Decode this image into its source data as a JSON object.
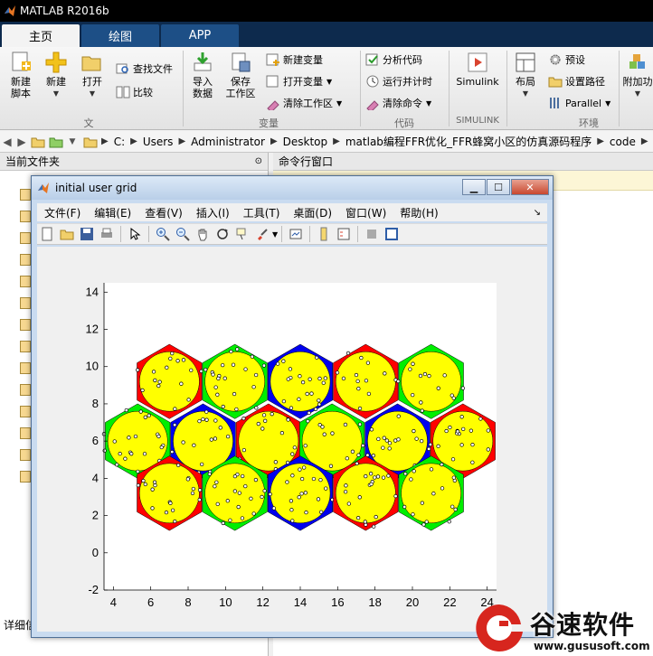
{
  "app": {
    "title": "MATLAB R2016b"
  },
  "tabs": [
    {
      "label": "主页",
      "active": true
    },
    {
      "label": "绘图",
      "active": false
    },
    {
      "label": "APP",
      "active": false
    }
  ],
  "ribbon": {
    "new_script": "新建\n脚本",
    "new": "新建",
    "open": "打开",
    "find_files": "查找文件",
    "compare": "比较",
    "import_data": "导入\n数据",
    "save_workspace": "保存\n工作区",
    "new_variable": "新建变量",
    "open_variable": "打开变量",
    "clear_workspace": "清除工作区",
    "analyze_code": "分析代码",
    "run_and_time": "运行并计时",
    "clear_commands": "清除命令",
    "simulink": "Simulink",
    "layout": "布局",
    "preferences": "预设",
    "set_path": "设置路径",
    "parallel": "Parallel",
    "addons": "附加功",
    "groups": {
      "file": "文件",
      "variable": "变量",
      "code": "代码",
      "simulink": "SIMULINK",
      "environment": "环境"
    }
  },
  "address": {
    "crumbs": [
      "C:",
      "Users",
      "Administrator",
      "Desktop",
      "matlab编程FFR优化_FFR蜂窝小区的仿真源码程序",
      "code"
    ]
  },
  "left_panel": {
    "title": "当前文件夹",
    "detail": "详细信"
  },
  "right_panel": {
    "title": "命令行窗口"
  },
  "figure": {
    "title": "initial user grid",
    "menu": [
      "文件(F)",
      "编辑(E)",
      "查看(V)",
      "插入(I)",
      "工具(T)",
      "桌面(D)",
      "窗口(W)",
      "帮助(H)"
    ]
  },
  "chart_data": {
    "type": "scatter",
    "title": "",
    "xlabel": "",
    "ylabel": "",
    "xlim": [
      3.5,
      24.5
    ],
    "ylim": [
      -2,
      14.5
    ],
    "xticks": [
      4,
      6,
      8,
      10,
      12,
      14,
      16,
      18,
      20,
      22,
      24
    ],
    "yticks": [
      -2,
      0,
      2,
      4,
      6,
      8,
      10,
      12,
      14
    ],
    "hex_radius": 2,
    "inner_circle_radius": 1.6,
    "colors": {
      "red": "#ff0000",
      "green": "#00ee00",
      "blue": "#0000ee",
      "yellow": "#ffff00"
    },
    "cells": [
      {
        "cx": 7,
        "cy": 9.2,
        "color": "red"
      },
      {
        "cx": 10.5,
        "cy": 9.2,
        "color": "green"
      },
      {
        "cx": 14,
        "cy": 9.2,
        "color": "blue"
      },
      {
        "cx": 17.5,
        "cy": 9.2,
        "color": "red"
      },
      {
        "cx": 21,
        "cy": 9.2,
        "color": "green"
      },
      {
        "cx": 5.3,
        "cy": 6,
        "color": "green"
      },
      {
        "cx": 8.8,
        "cy": 6,
        "color": "blue"
      },
      {
        "cx": 12.3,
        "cy": 6,
        "color": "red"
      },
      {
        "cx": 15.7,
        "cy": 6,
        "color": "green"
      },
      {
        "cx": 19.2,
        "cy": 6,
        "color": "blue"
      },
      {
        "cx": 22.7,
        "cy": 6,
        "color": "red"
      },
      {
        "cx": 7,
        "cy": 3.2,
        "color": "red"
      },
      {
        "cx": 10.5,
        "cy": 3.2,
        "color": "green"
      },
      {
        "cx": 14,
        "cy": 3.2,
        "color": "blue"
      },
      {
        "cx": 17.5,
        "cy": 3.2,
        "color": "red"
      },
      {
        "cx": 21,
        "cy": 3.2,
        "color": "green"
      }
    ]
  },
  "brand": {
    "name": "谷速软件",
    "url": "www.gususoft.com"
  }
}
